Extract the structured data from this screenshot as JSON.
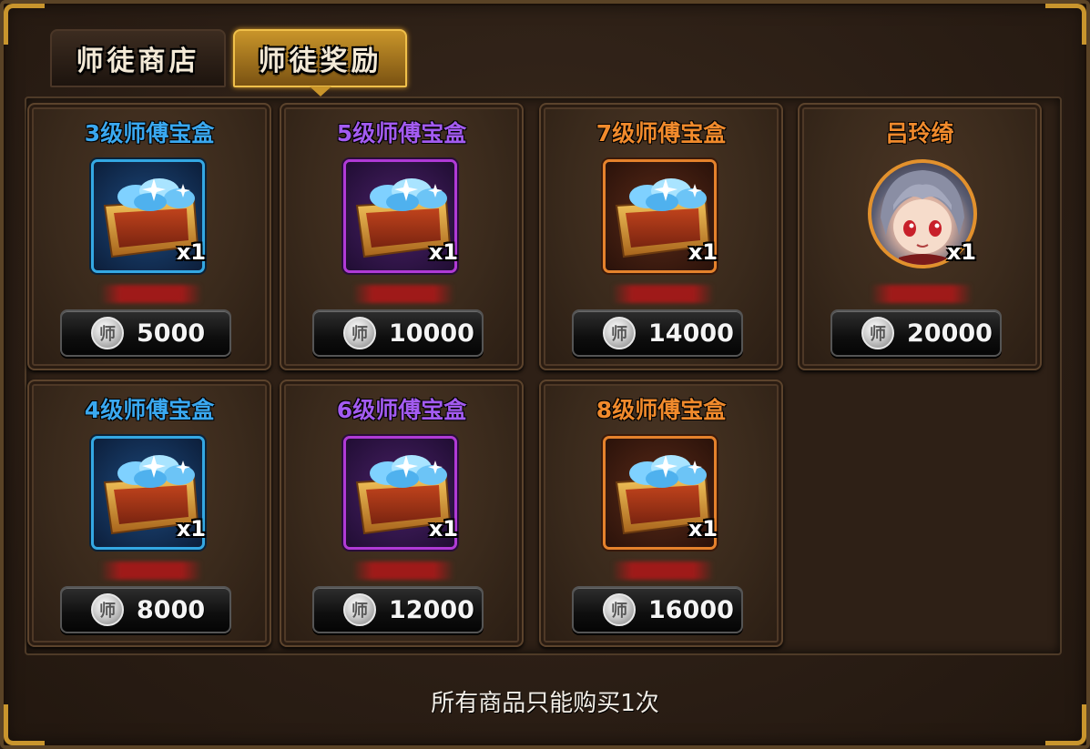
{
  "tabs": [
    {
      "label": "师徒商店",
      "active": false
    },
    {
      "label": "师徒奖励",
      "active": true
    }
  ],
  "items": [
    {
      "title": "3级师傅宝盒",
      "title_color": "#3aa8f0",
      "quality": "blue",
      "qty": "x1",
      "price": "5000"
    },
    {
      "title": "5级师傅宝盒",
      "title_color": "#a35bf0",
      "quality": "purple",
      "qty": "x1",
      "price": "10000"
    },
    {
      "title": "7级师傅宝盒",
      "title_color": "#f08a2c",
      "quality": "orange",
      "qty": "x1",
      "price": "14000"
    },
    {
      "title": "吕玲绮",
      "title_color": "#f08a2c",
      "quality": "hero",
      "qty": "x1",
      "price": "20000"
    },
    {
      "title": "4级师傅宝盒",
      "title_color": "#3aa8f0",
      "quality": "blue",
      "qty": "x1",
      "price": "8000"
    },
    {
      "title": "6级师傅宝盒",
      "title_color": "#a35bf0",
      "quality": "purple",
      "qty": "x1",
      "price": "12000"
    },
    {
      "title": "8级师傅宝盒",
      "title_color": "#f08a2c",
      "quality": "orange",
      "qty": "x1",
      "price": "16000"
    }
  ],
  "currency": {
    "glyph": "师",
    "icon": "master-coin-icon"
  },
  "footer_note": "所有商品只能购买1次"
}
